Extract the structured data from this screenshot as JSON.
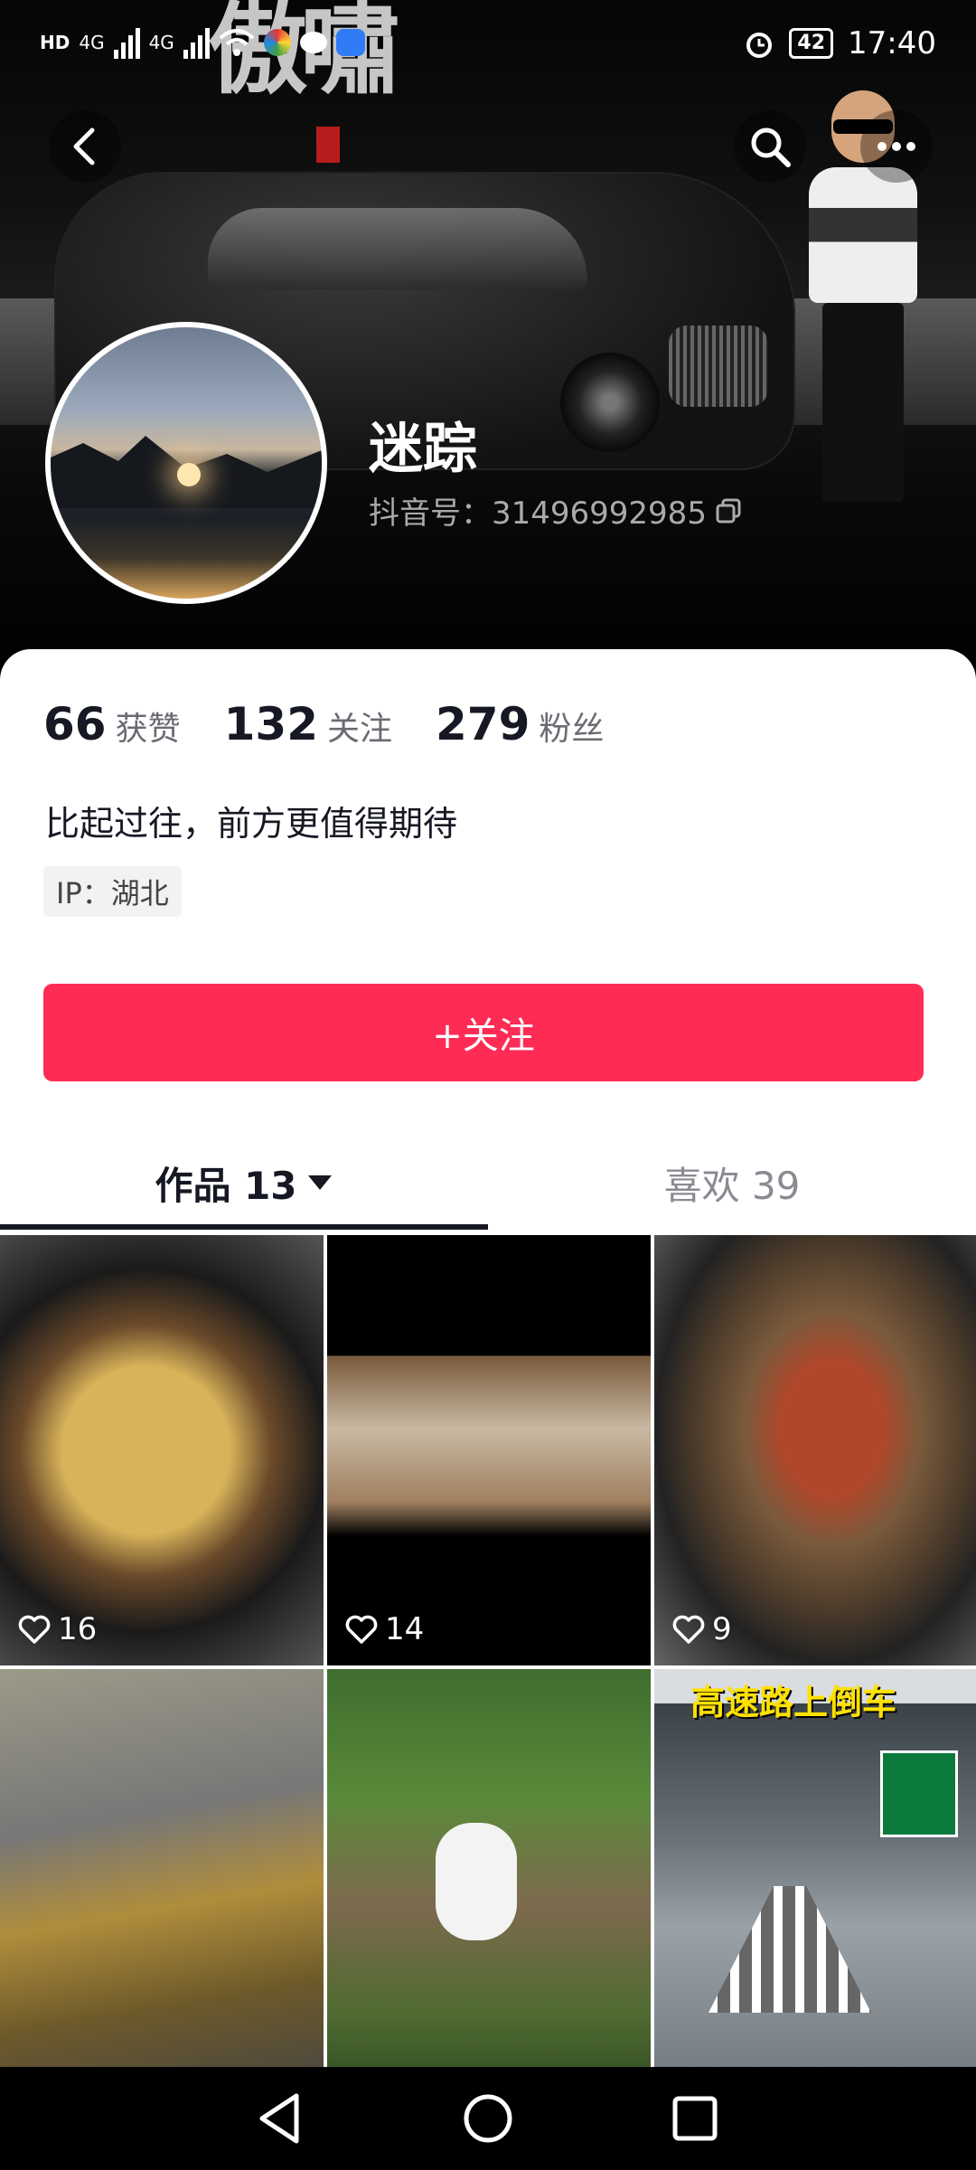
{
  "status_bar": {
    "network_labels": [
      "HD",
      "4G",
      "4G"
    ],
    "battery": "42",
    "time": "17:40"
  },
  "profile": {
    "nickname": "迷踪",
    "douyin_id": "抖音号：31496992985",
    "bio": "比起过往，前方更值得期待",
    "ip": "IP：湖北"
  },
  "stats": [
    {
      "value": "66",
      "label": "获赞"
    },
    {
      "value": "132",
      "label": "关注"
    },
    {
      "value": "279",
      "label": "粉丝"
    }
  ],
  "follow_button": "+关注",
  "tabs": [
    {
      "label": "作品 13",
      "active": true
    },
    {
      "label": "喜欢 39",
      "active": false
    }
  ],
  "videos": [
    {
      "likes": "16"
    },
    {
      "likes": "14"
    },
    {
      "likes": "9"
    },
    {
      "likes": ""
    },
    {
      "likes": ""
    },
    {
      "likes": "",
      "caption": "高速路上倒车"
    }
  ],
  "colors": {
    "accent": "#fe2c55",
    "text": "#161823",
    "muted": "#8a8a92"
  },
  "icons": [
    "back-arrow-icon",
    "search-icon",
    "more-icon",
    "copy-icon",
    "alarm-icon",
    "wifi-icon",
    "heart-icon",
    "triangle-down-icon",
    "nav-back-icon",
    "nav-home-icon",
    "nav-recents-icon"
  ]
}
